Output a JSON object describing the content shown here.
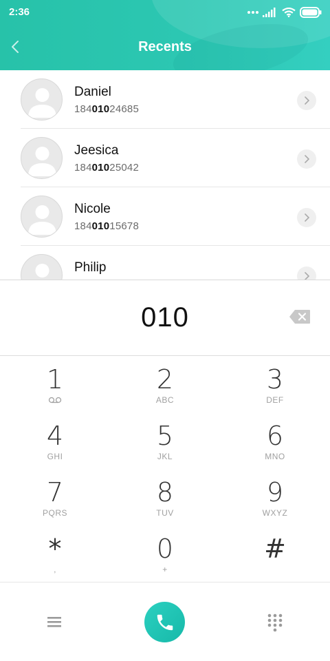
{
  "status_bar": {
    "time": "2:36"
  },
  "header": {
    "title": "Recents"
  },
  "contacts": [
    {
      "name": "Daniel",
      "number_prefix": "184",
      "number_match": "010",
      "number_suffix": "24685"
    },
    {
      "name": "Jeesica",
      "number_prefix": "184",
      "number_match": "010",
      "number_suffix": "25042"
    },
    {
      "name": "Nicole",
      "number_prefix": "184",
      "number_match": "010",
      "number_suffix": "15678"
    },
    {
      "name": "Philip",
      "number_prefix": "",
      "number_match": "",
      "number_suffix": ""
    }
  ],
  "dialer": {
    "input": "010"
  },
  "keypad": [
    {
      "digit": "1",
      "letters": "voicemail"
    },
    {
      "digit": "2",
      "letters": "ABC"
    },
    {
      "digit": "3",
      "letters": "DEF"
    },
    {
      "digit": "4",
      "letters": "GHI"
    },
    {
      "digit": "5",
      "letters": "JKL"
    },
    {
      "digit": "6",
      "letters": "MNO"
    },
    {
      "digit": "7",
      "letters": "PQRS"
    },
    {
      "digit": "8",
      "letters": "TUV"
    },
    {
      "digit": "9",
      "letters": "WXYZ"
    },
    {
      "digit": "*",
      "letters": ","
    },
    {
      "digit": "0",
      "letters": "+"
    },
    {
      "digit": "#",
      "letters": ""
    }
  ],
  "icons": {
    "back": "chevron-left-icon",
    "row_action": "chevron-right-icon",
    "backspace": "backspace-icon",
    "menu": "menu-icon",
    "call": "phone-icon",
    "keypad_toggle": "dialpad-icon",
    "avatar": "person-placeholder-icon",
    "voicemail": "voicemail-icon"
  },
  "colors": {
    "header_accent": "#2cc7b2",
    "call_button": "#1fc3b2",
    "matched_digits": "#111111",
    "secondary_text": "#6b6b6b"
  }
}
